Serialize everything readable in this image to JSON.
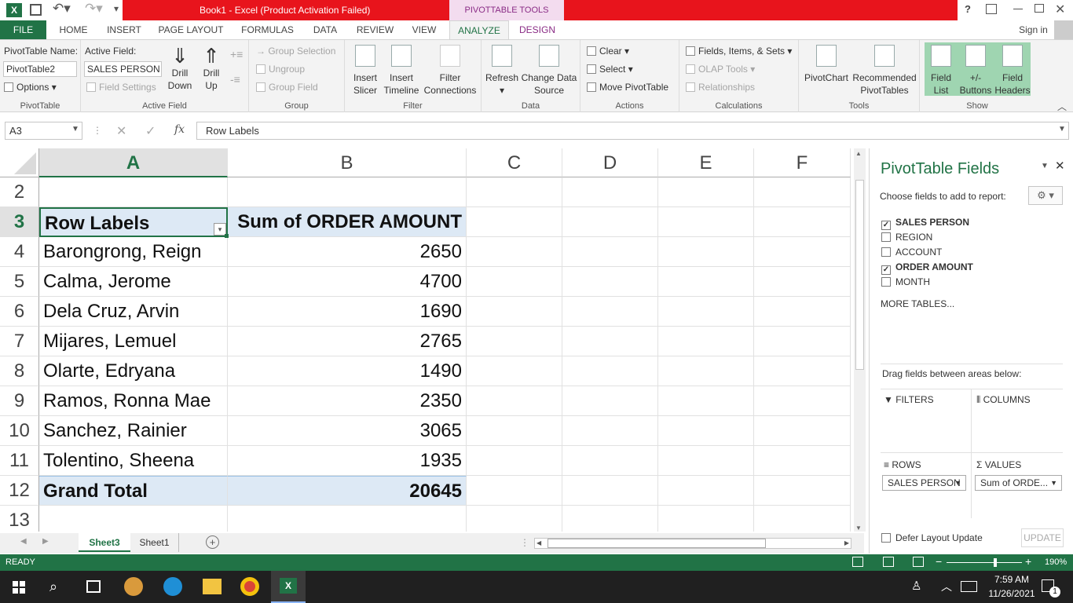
{
  "window": {
    "title": "Book1 -  Excel (Product Activation Failed)",
    "context_tools": "PIVOTTABLE TOOLS",
    "help": "?",
    "signin": "Sign in"
  },
  "tabs": [
    "FILE",
    "HOME",
    "INSERT",
    "PAGE LAYOUT",
    "FORMULAS",
    "DATA",
    "REVIEW",
    "VIEW",
    "ANALYZE",
    "DESIGN"
  ],
  "ribbon": {
    "pivottable": {
      "name_label": "PivotTable Name:",
      "name_value": "PivotTable2",
      "options": "Options",
      "group": "PivotTable"
    },
    "active_field": {
      "label": "Active Field:",
      "value": "SALES PERSON",
      "field_settings": "Field Settings",
      "drill_down": "Drill\nDown",
      "drill_up": "Drill\nUp",
      "group": "Active Field"
    },
    "group": {
      "group_selection": "Group Selection",
      "ungroup": "Ungroup",
      "group_field": "Group Field",
      "group": "Group"
    },
    "filter": {
      "insert_slicer": "Insert\nSlicer",
      "insert_timeline": "Insert\nTimeline",
      "filter_connections": "Filter\nConnections",
      "group": "Filter"
    },
    "data": {
      "refresh": "Refresh",
      "change_source": "Change Data\nSource",
      "group": "Data"
    },
    "actions": {
      "clear": "Clear",
      "select": "Select",
      "move": "Move PivotTable",
      "group": "Actions"
    },
    "calculations": {
      "fields": "Fields, Items, & Sets",
      "olap": "OLAP Tools",
      "relationships": "Relationships",
      "group": "Calculations"
    },
    "tools": {
      "pivotchart": "PivotChart",
      "recommended": "Recommended\nPivotTables",
      "group": "Tools"
    },
    "show": {
      "field_list": "Field\nList",
      "buttons": "+/-\nButtons",
      "headers": "Field\nHeaders",
      "group": "Show"
    }
  },
  "formula_bar": {
    "name_box": "A3",
    "fx": "fx",
    "content": "Row Labels"
  },
  "columns": [
    "A",
    "B",
    "C",
    "D",
    "E",
    "F"
  ],
  "row_numbers": [
    "2",
    "3",
    "4",
    "5",
    "6",
    "7",
    "8",
    "9",
    "10",
    "11",
    "12",
    "13"
  ],
  "pivot": {
    "header": [
      "Row Labels",
      "Sum of ORDER AMOUNT"
    ],
    "rows": [
      [
        "Barongrong, Reign",
        "2650"
      ],
      [
        "Calma, Jerome",
        "4700"
      ],
      [
        "Dela Cruz, Arvin",
        "1690"
      ],
      [
        "Mijares, Lemuel",
        "2765"
      ],
      [
        "Olarte, Edryana",
        "1490"
      ],
      [
        "Ramos, Ronna Mae",
        "2350"
      ],
      [
        "Sanchez, Rainier",
        "3065"
      ],
      [
        "Tolentino, Sheena",
        "1935"
      ]
    ],
    "total": [
      "Grand Total",
      "20645"
    ]
  },
  "sheets": [
    "Sheet3",
    "Sheet1"
  ],
  "fields_pane": {
    "title": "PivotTable Fields",
    "subtitle": "Choose fields to add to report:",
    "fields": [
      {
        "name": "SALES PERSON",
        "checked": true
      },
      {
        "name": "REGION",
        "checked": false
      },
      {
        "name": "ACCOUNT",
        "checked": false
      },
      {
        "name": "ORDER AMOUNT",
        "checked": true
      },
      {
        "name": "MONTH",
        "checked": false
      }
    ],
    "more_tables": "MORE TABLES...",
    "drag_hint": "Drag fields between areas below:",
    "filters": "FILTERS",
    "columns": "COLUMNS",
    "rows": "ROWS",
    "values": "VALUES",
    "rows_item": "SALES PERSON",
    "values_item": "Sum of ORDE...",
    "defer": "Defer Layout Update",
    "update": "UPDATE"
  },
  "status": {
    "ready": "READY",
    "zoom": "190%"
  },
  "taskbar": {
    "time": "7:59 AM",
    "date": "11/26/2021",
    "notifications": "1"
  }
}
